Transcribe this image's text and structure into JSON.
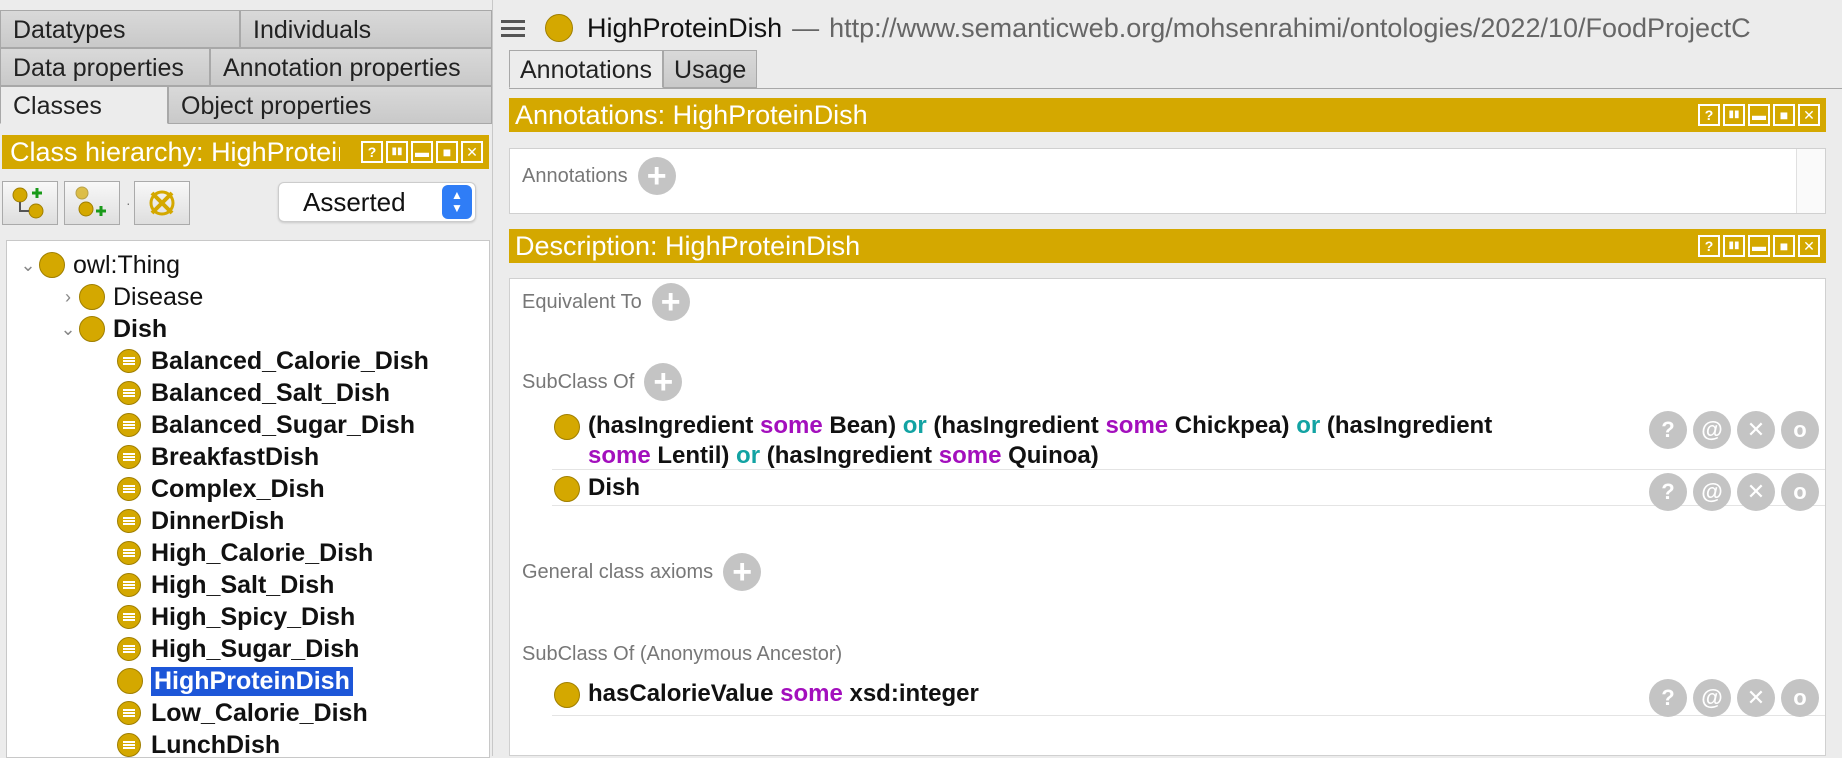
{
  "left": {
    "tabs_row1": [
      "Datatypes",
      "Individuals"
    ],
    "tabs_row2": [
      "Data properties",
      "Annotation properties"
    ],
    "tabs_row3": [
      "Classes",
      "Object properties"
    ],
    "view_title": "Class hierarchy: HighProteinDish",
    "view_buttons": [
      "?",
      "▮▮",
      "▬",
      "■",
      "✕"
    ],
    "dropdown_value": "Asserted",
    "tree": [
      {
        "label": "owl:Thing",
        "level": 0,
        "expander": "⌄",
        "icon": "class",
        "bold": false
      },
      {
        "label": "Disease",
        "level": 1,
        "expander": "›",
        "icon": "class",
        "bold": false
      },
      {
        "label": "Dish",
        "level": 1,
        "expander": "⌄",
        "icon": "class",
        "bold": true
      },
      {
        "label": "Balanced_Calorie_Dish",
        "level": 2,
        "expander": "",
        "icon": "defined",
        "bold": true
      },
      {
        "label": "Balanced_Salt_Dish",
        "level": 2,
        "expander": "",
        "icon": "defined",
        "bold": true
      },
      {
        "label": "Balanced_Sugar_Dish",
        "level": 2,
        "expander": "",
        "icon": "defined",
        "bold": true
      },
      {
        "label": "BreakfastDish",
        "level": 2,
        "expander": "",
        "icon": "defined",
        "bold": true
      },
      {
        "label": "Complex_Dish",
        "level": 2,
        "expander": "",
        "icon": "defined",
        "bold": true
      },
      {
        "label": "DinnerDish",
        "level": 2,
        "expander": "",
        "icon": "defined",
        "bold": true
      },
      {
        "label": "High_Calorie_Dish",
        "level": 2,
        "expander": "",
        "icon": "defined",
        "bold": true
      },
      {
        "label": "High_Salt_Dish",
        "level": 2,
        "expander": "",
        "icon": "defined",
        "bold": true
      },
      {
        "label": "High_Spicy_Dish",
        "level": 2,
        "expander": "",
        "icon": "defined",
        "bold": true
      },
      {
        "label": "High_Sugar_Dish",
        "level": 2,
        "expander": "",
        "icon": "defined",
        "bold": true
      },
      {
        "label": "HighProteinDish",
        "level": 2,
        "expander": "",
        "icon": "class",
        "bold": true,
        "selected": true
      },
      {
        "label": "Low_Calorie_Dish",
        "level": 2,
        "expander": "",
        "icon": "defined",
        "bold": true
      },
      {
        "label": "LunchDish",
        "level": 2,
        "expander": "",
        "icon": "defined",
        "bold": true
      }
    ]
  },
  "right": {
    "entity_name": "HighProteinDish",
    "entity_sep": "—",
    "entity_iri": "http://www.semanticweb.org/mohsenrahimi/ontologies/2022/10/FoodProjectC",
    "tabs": [
      "Annotations",
      "Usage"
    ],
    "annotations_bar": "Annotations: HighProteinDish",
    "annotations_label": "Annotations",
    "description_bar": "Description: HighProteinDish",
    "sections": {
      "equivalent_to": "Equivalent To",
      "subclass_of": "SubClass Of",
      "general_axioms": "General class axioms",
      "anon_ancestor": "SubClass Of (Anonymous Ancestor)"
    },
    "row_buttons": [
      "?",
      "@",
      "✕",
      "o"
    ],
    "subclass_rows": [
      {
        "lines": [
          [
            [
              "(hasIngredient ",
              ""
            ],
            [
              "some",
              "some"
            ],
            [
              " Bean) ",
              ""
            ],
            [
              "or",
              "or"
            ],
            [
              " (hasIngredient ",
              ""
            ],
            [
              "some",
              "some"
            ],
            [
              " Chickpea) ",
              ""
            ],
            [
              "or",
              "or"
            ],
            [
              " (hasIngredient",
              ""
            ]
          ],
          [
            [
              "some",
              "some"
            ],
            [
              " Lentil) ",
              ""
            ],
            [
              "or",
              "or"
            ],
            [
              " (hasIngredient ",
              ""
            ],
            [
              "some",
              "some"
            ],
            [
              " Quinoa)",
              ""
            ]
          ]
        ]
      },
      {
        "lines": [
          [
            [
              "Dish",
              ""
            ]
          ]
        ]
      }
    ],
    "ancestor_rows": [
      {
        "lines": [
          [
            [
              "hasCalorieValue ",
              ""
            ],
            [
              "some",
              "some"
            ],
            [
              " xsd:integer",
              ""
            ]
          ]
        ]
      }
    ]
  },
  "colors": {
    "accent": "#d4a800",
    "selection": "#1d56d8",
    "keyword_some": "#a30fbd",
    "keyword_or": "#12a3a3"
  }
}
